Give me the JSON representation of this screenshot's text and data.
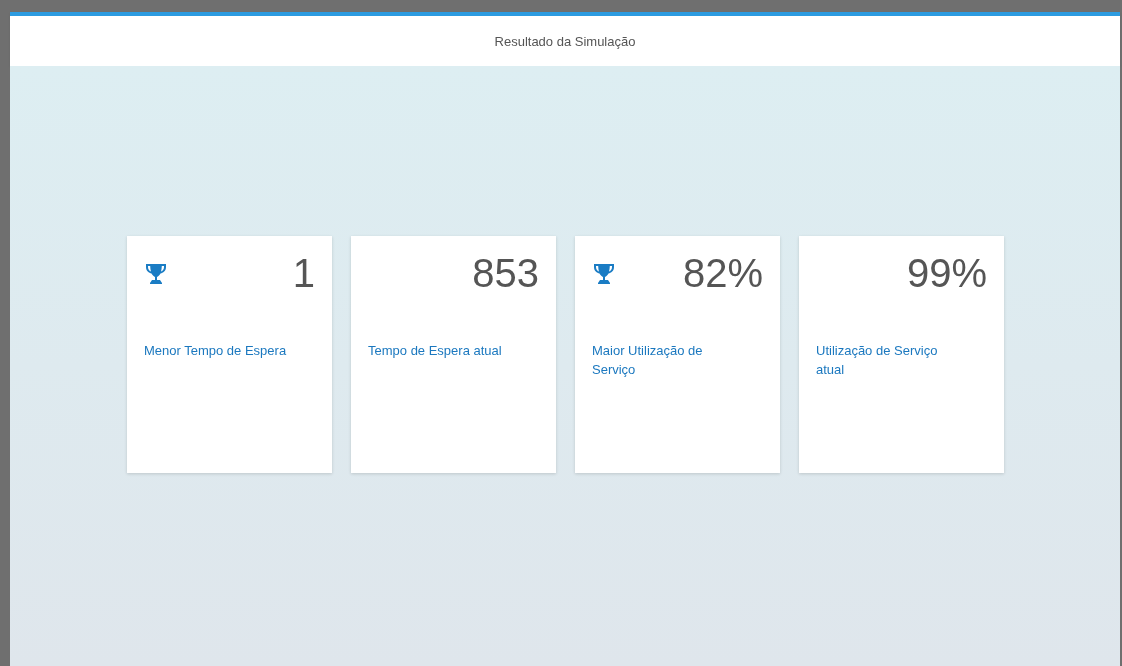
{
  "header": {
    "title": "Resultado da Simulação"
  },
  "tiles": [
    {
      "value": "1",
      "label": "Menor Tempo de Espera",
      "trophy": true
    },
    {
      "value": "853",
      "label": "Tempo de Espera atual",
      "trophy": false
    },
    {
      "value": "82%",
      "label": "Maior Utilização de Serviço",
      "trophy": true
    },
    {
      "value": "99%",
      "label": "Utilização de Serviço atual",
      "trophy": false
    }
  ]
}
